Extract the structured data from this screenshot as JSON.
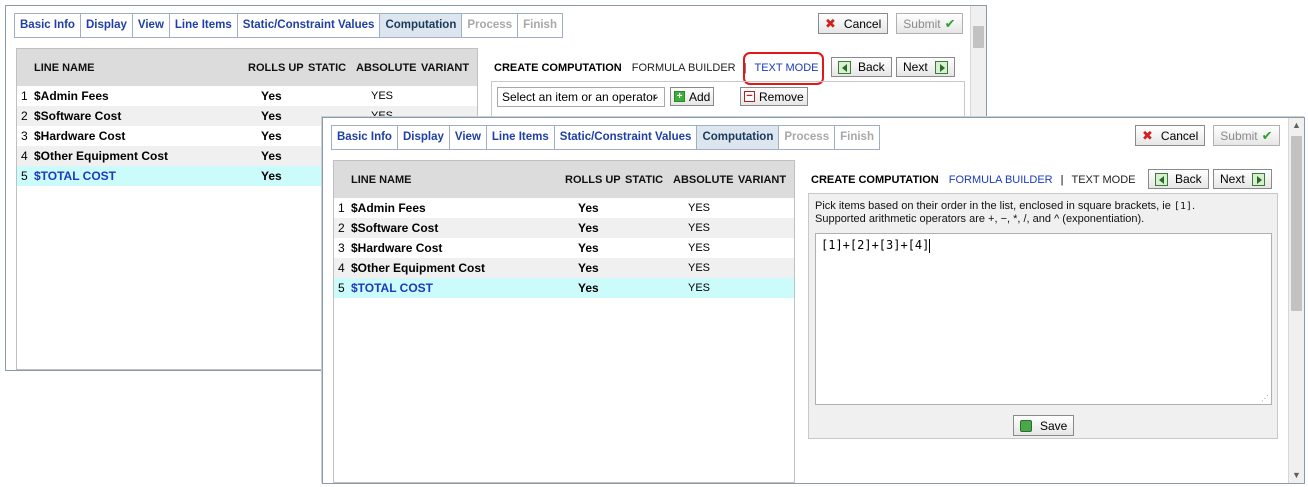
{
  "tabs": [
    {
      "label": "Basic Info",
      "state": "normal"
    },
    {
      "label": "Display",
      "state": "normal"
    },
    {
      "label": "View",
      "state": "normal"
    },
    {
      "label": "Line Items",
      "state": "normal"
    },
    {
      "label": "Static/Constraint Values",
      "state": "normal"
    },
    {
      "label": "Computation",
      "state": "active"
    },
    {
      "label": "Process",
      "state": "disabled"
    },
    {
      "label": "Finish",
      "state": "disabled"
    }
  ],
  "buttons": {
    "cancel": "Cancel",
    "submit": "Submit",
    "back": "Back",
    "next": "Next",
    "add": "Add",
    "remove": "Remove",
    "save": "Save"
  },
  "list": {
    "headers": {
      "line_name": "LINE NAME",
      "rolls_up": "ROLLS UP",
      "static": "STATIC",
      "absolute": "ABSOLUTE",
      "variant": "VARIANT"
    },
    "rows": [
      {
        "num": "1",
        "name": "$Admin Fees",
        "rolls_up": "Yes",
        "absolute": "YES"
      },
      {
        "num": "2",
        "name": "$Software Cost",
        "rolls_up": "Yes",
        "absolute": "YES"
      },
      {
        "num": "3",
        "name": "$Hardware Cost",
        "rolls_up": "Yes",
        "absolute": "YES"
      },
      {
        "num": "4",
        "name": "$Other Equipment Cost",
        "rolls_up": "Yes",
        "absolute": "YES"
      },
      {
        "num": "5",
        "name": "$TOTAL COST",
        "rolls_up": "Yes",
        "absolute": "YES"
      }
    ]
  },
  "computation": {
    "title": "CREATE COMPUTATION",
    "formula_builder": "FORMULA BUILDER",
    "text_mode": "TEXT MODE",
    "separator": "|",
    "select_placeholder": "Select an item or an operator",
    "instructions_1": "Pick items based on their order in the list, enclosed in square brackets, ie",
    "instructions_1_code": "[1]",
    "instructions_1_end": ".",
    "instructions_2": "Supported arithmetic operators are +, −, *, /, and ^ (exponentiation).",
    "formula": "[1]+[2]+[3]+[4]"
  },
  "colors": {
    "highlight": "#e01818",
    "selected_row": "#ccfbfb",
    "link": "#1a3ac0"
  }
}
